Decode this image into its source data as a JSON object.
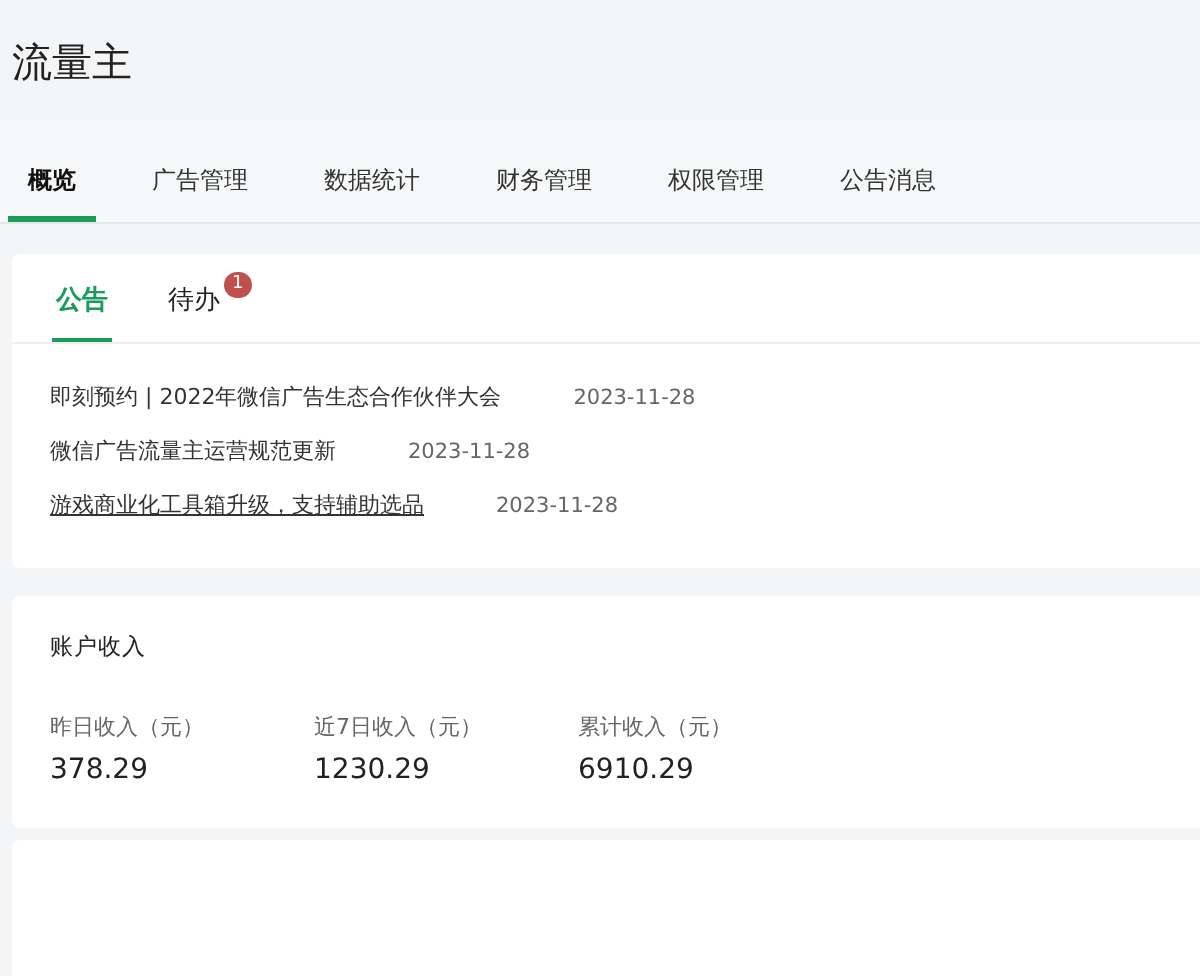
{
  "page_title": "流量主",
  "tabs": [
    {
      "label": "概览",
      "selected": true
    },
    {
      "label": "广告管理",
      "selected": false
    },
    {
      "label": "数据统计",
      "selected": false
    },
    {
      "label": "财务管理",
      "selected": false
    },
    {
      "label": "权限管理",
      "selected": false
    },
    {
      "label": "公告消息",
      "selected": false
    }
  ],
  "notice_card": {
    "tabs": [
      {
        "label": "公告",
        "selected": true
      },
      {
        "label": "待办",
        "selected": false,
        "badge": "1"
      }
    ],
    "items": [
      {
        "title": "即刻预约 | 2022年微信广告生态合作伙伴大会",
        "date": "2023-11-28",
        "hovered": false
      },
      {
        "title": "微信广告流量主运营规范更新",
        "date": "2023-11-28",
        "hovered": false
      },
      {
        "title": "游戏商业化工具箱升级，支持辅助选品",
        "date": "2023-11-28",
        "hovered": true
      }
    ]
  },
  "income_card": {
    "title": "账户收入",
    "stats": [
      {
        "label": "昨日收入（元）",
        "value": "378.29"
      },
      {
        "label": "近7日收入（元）",
        "value": "1230.29"
      },
      {
        "label": "累计收入（元）",
        "value": "6910.29"
      }
    ]
  }
}
